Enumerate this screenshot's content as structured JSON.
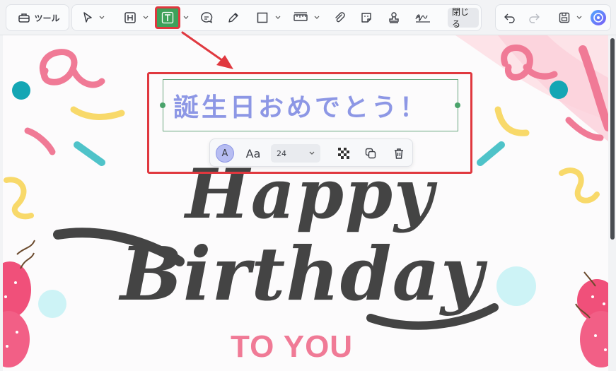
{
  "toolbar": {
    "tools_label": "ツール",
    "close_label": "閉じる"
  },
  "annotation": {
    "text": "誕生日おめでとう！",
    "font_size": "24",
    "font_label": "Aa",
    "color_label": "A",
    "text_color": "#8d97e5"
  },
  "card": {
    "happy": "Happy",
    "birthday": "Birthday",
    "to_you": "TO YOU"
  },
  "colors": {
    "accent_green": "#3ea15a",
    "highlight_red": "#e0383f",
    "pink": "#f07a96"
  }
}
